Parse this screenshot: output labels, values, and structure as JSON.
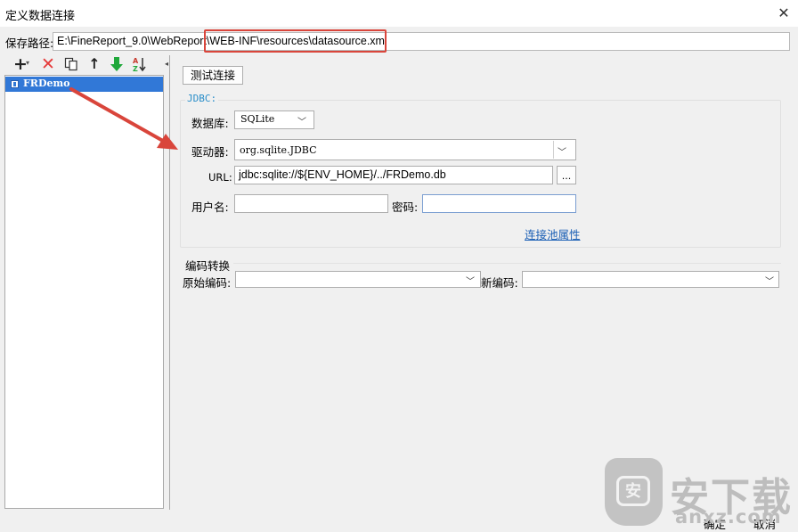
{
  "window": {
    "title": "定义数据连接",
    "close_glyph": "✕"
  },
  "save_path": {
    "label": "保存路径:",
    "value": "E:\\FineReport_9.0\\WebReport\\WEB-INF\\resources\\datasource.xml"
  },
  "toolbar": {
    "add_glyph": "+",
    "caret_glyph": "▾",
    "delete_glyph": "✕",
    "up_glyph": "↑",
    "down_glyph": "🡇",
    "collapse_glyph": "◂"
  },
  "connections": {
    "items": [
      {
        "label": "FRDemo"
      }
    ]
  },
  "form": {
    "test_button": "测试连接",
    "jdbc_title": "JDBC:",
    "database_label": "数据库:",
    "database_value": "SQLite",
    "driver_label": "驱动器:",
    "driver_value": "org.sqlite.JDBC",
    "url_label": "URL:",
    "url_value": "jdbc:sqlite://${ENV_HOME}/../FRDemo.db",
    "url_more": "...",
    "username_label": "用户名:",
    "username_value": "",
    "password_label": "密码:",
    "password_value": "",
    "pool_link": "连接池属性",
    "encoding_title": "编码转换",
    "original_encoding_label": "原始编码:",
    "original_encoding_value": "",
    "new_encoding_label": "新编码:",
    "new_encoding_value": "",
    "chevron_glyph": "﹀"
  },
  "footer": {
    "ok": "确定",
    "cancel": "取消"
  },
  "watermark": {
    "cn": "安下载",
    "en": "anxz.com",
    "shield_char": "安"
  },
  "colors": {
    "selection": "#3178d7",
    "annotation_red": "#d9453b",
    "link": "#1b5fb5",
    "jdbc_title": "#2a8ec9"
  }
}
